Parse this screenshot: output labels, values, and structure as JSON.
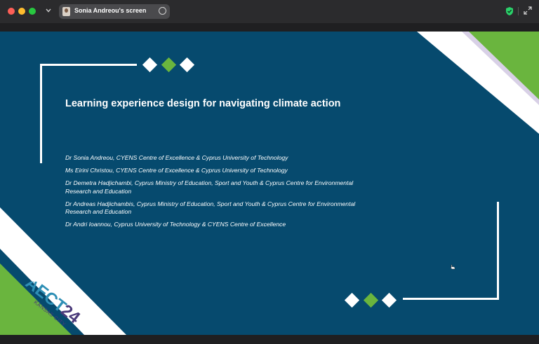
{
  "window": {
    "share_label": "Sonia Andreou's screen"
  },
  "slide": {
    "title": "Learning experience design for navigating climate action",
    "authors": [
      "Dr Sonia Andreou, CYENS Centre of Excellence & Cyprus University of Technology",
      "Ms Eirini Christou, CYENS Centre of Excellence & Cyprus University of Technology",
      "Dr Demetra Hadjichambi, Cyprus Ministry of Education, Sport and Youth & Cyprus Centre for Environmental Research and Education",
      "Dr Andreas Hadjichambis, Cyprus Ministry of Education, Sport and Youth & Cyprus Centre for Environmental Research and Education",
      "Dr Andri Ioannou, Cyprus University of Technology & CYENS Centre of Excellence"
    ],
    "logo": {
      "wordmark": "AECT",
      "year": "24",
      "city": "KANSAS CITY"
    }
  },
  "colors": {
    "slide_bg": "#064a6e",
    "accent_green": "#6ab53e",
    "white": "#ffffff",
    "logo_purple": "#4a3a7a"
  },
  "icons": {
    "close": "red-close-dot",
    "minimize": "yellow-minimize-dot",
    "zoom": "green-zoom-dot",
    "dropdown": "chevron-down-icon",
    "options": "ellipsis-icon",
    "security": "shield-check-icon",
    "fullscreen": "expand-icon",
    "pointer": "hand-cursor-icon"
  }
}
